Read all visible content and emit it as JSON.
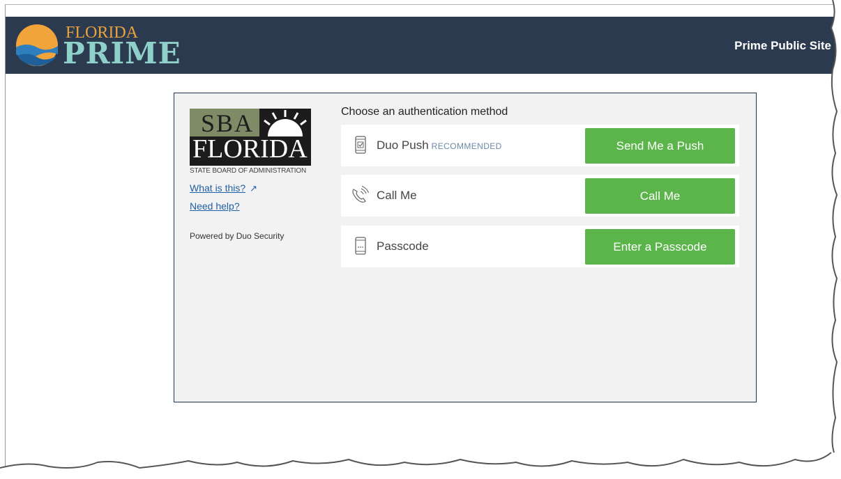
{
  "header": {
    "logo_top": "FLORIDA",
    "logo_bottom": "PRIME",
    "public_site_link": "Prime Public Site"
  },
  "sidebar": {
    "logo_line1": "SBA",
    "logo_line2": "FLORIDA",
    "logo_subtitle": "STATE BOARD OF ADMINISTRATION",
    "what_is_this": "What is this?",
    "need_help": "Need help?",
    "powered_by": "Powered by Duo Security"
  },
  "auth": {
    "title": "Choose an authentication method",
    "methods": [
      {
        "label": "Duo Push",
        "badge": "RECOMMENDED",
        "button": "Send Me a Push",
        "icon": "phone-check-icon"
      },
      {
        "label": "Call Me",
        "badge": "",
        "button": "Call Me",
        "icon": "phone-ring-icon"
      },
      {
        "label": "Passcode",
        "badge": "",
        "button": "Enter a Passcode",
        "icon": "passcode-device-icon"
      }
    ]
  },
  "colors": {
    "header_bg": "#2b3a4f",
    "button_green": "#5bb54a",
    "panel_bg": "#f2f2f2",
    "link_blue": "#1f5fa6"
  }
}
